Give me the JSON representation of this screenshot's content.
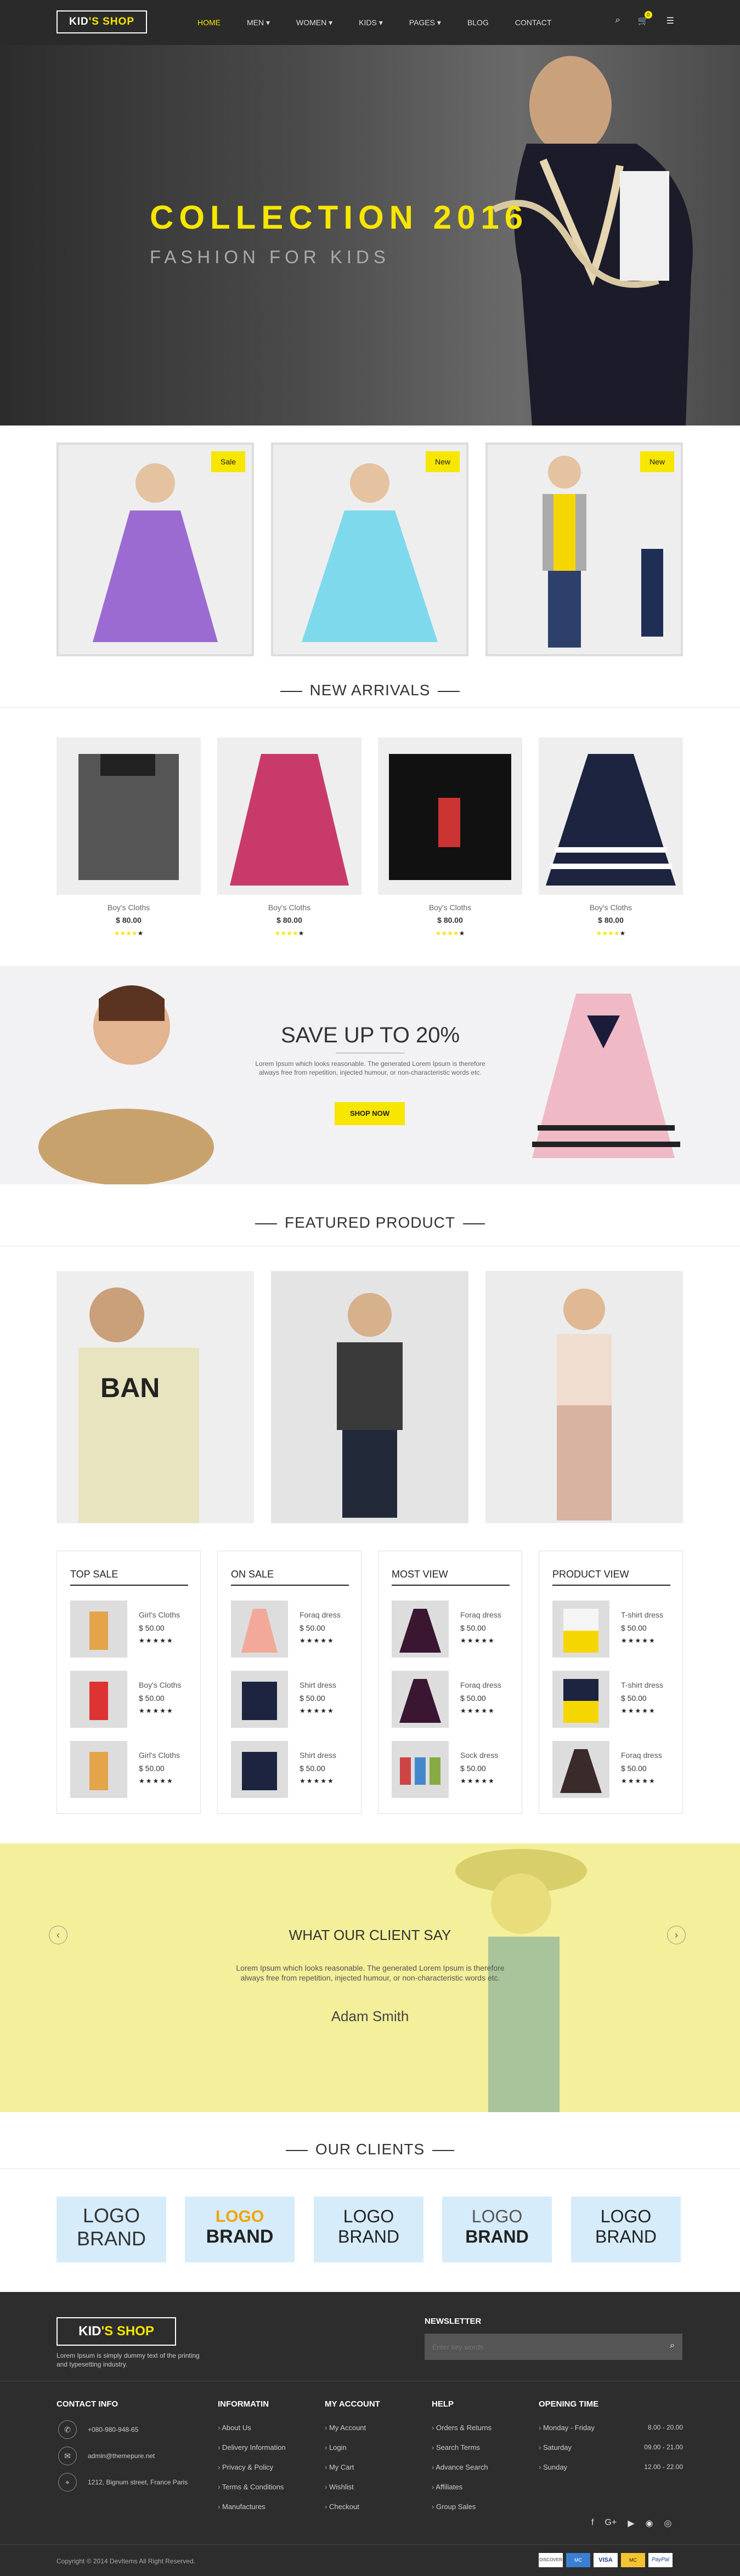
{
  "header": {
    "logo_prefix": "KID",
    "logo_apostrophe": "'S",
    "logo_suffix": " SHOP",
    "nav": [
      "HOME",
      "MEN ▾",
      "WOMEN ▾",
      "KIDS ▾",
      "PAGES ▾",
      "BLOG",
      "CONTACT"
    ],
    "cart_count": "0"
  },
  "hero": {
    "title": "COLLECTION 2016",
    "subtitle": "FASHION FOR KIDS"
  },
  "promo_cards": [
    {
      "badge": "Sale"
    },
    {
      "badge": "New"
    },
    {
      "badge": "New"
    }
  ],
  "new_arrivals": {
    "title": "NEW ARRIVALS",
    "items": [
      {
        "name": "Boy's Cloths",
        "price": "$ 80.00"
      },
      {
        "name": "Boy's Cloths",
        "price": "$ 80.00"
      },
      {
        "name": "Boy's Cloths",
        "price": "$ 80.00"
      },
      {
        "name": "Boy's Cloths",
        "price": "$ 80.00"
      }
    ],
    "rating": 4
  },
  "save_banner": {
    "title": "SAVE UP TO 20%",
    "text": "Lorem Ipsum which looks reasonable. The generated Lorem Ipsum is therefore always free from repetition, injected humour, or non-characteristic words etc.",
    "button": "SHOP NOW"
  },
  "featured": {
    "title": "FEATURED PRODUCT"
  },
  "panels": [
    {
      "title": "TOP SALE",
      "items": [
        {
          "name": "Girl's Cloths",
          "price": "$ 50.00"
        },
        {
          "name": "Boy's Cloths",
          "price": "$ 50.00"
        },
        {
          "name": "Girl's Cloths",
          "price": "$ 50.00"
        }
      ]
    },
    {
      "title": "ON SALE",
      "items": [
        {
          "name": "Foraq dress",
          "price": "$ 50.00"
        },
        {
          "name": "Shirt dress",
          "price": "$ 50.00"
        },
        {
          "name": "Shirt dress",
          "price": "$ 50.00"
        }
      ]
    },
    {
      "title": "MOST VIEW",
      "items": [
        {
          "name": "Foraq dress",
          "price": "$ 50.00"
        },
        {
          "name": "Foraq dress",
          "price": "$ 50.00"
        },
        {
          "name": "Sock dress",
          "price": "$ 50.00"
        }
      ]
    },
    {
      "title": "PRODUCT VIEW",
      "items": [
        {
          "name": "T-shirt dress",
          "price": "$ 50.00"
        },
        {
          "name": "T-shirt dress",
          "price": "$ 50.00"
        },
        {
          "name": "Foraq dress",
          "price": "$ 50.00"
        }
      ]
    }
  ],
  "panel_stars": "★★★★★",
  "testimonial": {
    "title": "WHAT OUR CLIENT SAY",
    "quote": "Lorem Ipsum which looks reasonable. The generated Lorem Ipsum is therefore always free from repetition, injected humour, or non-characteristic words etc.",
    "author": "Adam Smith"
  },
  "clients": {
    "title": "OUR CLIENTS",
    "logos": [
      {
        "line1": "LOGO",
        "line2": "BRAND"
      },
      {
        "line1": "LOGO",
        "line2": "BRAND"
      },
      {
        "line1": "LOGO",
        "line2": "BRAND"
      },
      {
        "line1": "LOGO",
        "line2": "BRAND"
      },
      {
        "line1": "LOGO",
        "line2": "BRAND"
      }
    ]
  },
  "footer": {
    "about": "Lorem Ipsum is simply dummy text of the printing and typesetting industry.",
    "newsletter_title": "NEWSLETTER",
    "newsletter_placeholder": "Enter key words",
    "contact_title": "CONTACT INFO",
    "contact": [
      "+080-980-948-65",
      "admin@themepure.net",
      "1212, Bignum street, France Paris"
    ],
    "info_title": "INFORMATIN",
    "info_links": [
      "About Us",
      "Delivery Information",
      "Privacy & Policy",
      "Terms & Conditions",
      "Manufactures"
    ],
    "account_title": "MY ACCOUNT",
    "account_links": [
      "My Account",
      "Login",
      "My Cart",
      "Wishlist",
      "Checkout"
    ],
    "help_title": "HELP",
    "help_links": [
      "Orders & Returns",
      "Search Terms",
      "Advance Search",
      "Affiliates",
      "Group Sales"
    ],
    "opening_title": "OPENING TIME",
    "opening": [
      {
        "day": "Monday - Friday",
        "time": "8.00 - 20.00"
      },
      {
        "day": "Saturday",
        "time": "09.00 - 21.00"
      },
      {
        "day": "Sunday",
        "time": "12.00 - 22.00"
      }
    ],
    "copyright": "Copyright © 2014 DevItems All Right Reserved.",
    "payments": [
      "DISCOVER",
      "MC",
      "VISA",
      "MC",
      "PayPal"
    ]
  },
  "colors": {
    "accent": "#f6e600",
    "dark": "#2a2a2a",
    "client_bg": "#d6ecfa",
    "testimonial_bg": "#f3ef9a"
  }
}
